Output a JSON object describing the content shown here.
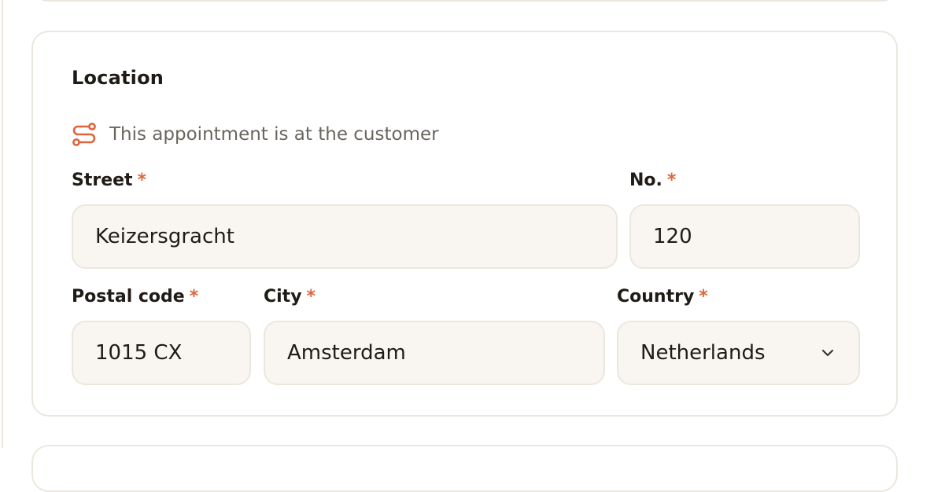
{
  "location": {
    "title": "Location",
    "notice_text": "This appointment is at the customer",
    "fields": {
      "street": {
        "label": "Street",
        "value": "Keizersgracht",
        "required_mark": "*"
      },
      "number": {
        "label": "No.",
        "value": "120",
        "required_mark": "*"
      },
      "postal_code": {
        "label": "Postal code",
        "value": "1015 CX",
        "required_mark": "*"
      },
      "city": {
        "label": "City",
        "value": "Amsterdam",
        "required_mark": "*"
      },
      "country": {
        "label": "Country",
        "value": "Netherlands",
        "required_mark": "*"
      }
    }
  },
  "icons": {
    "notice": "route-icon",
    "country_select": "chevron-down-icon"
  },
  "colors": {
    "accent": "#e0653a",
    "field_background": "#f9f6f1",
    "border": "#ebe7df",
    "muted_text": "#6b655e"
  }
}
